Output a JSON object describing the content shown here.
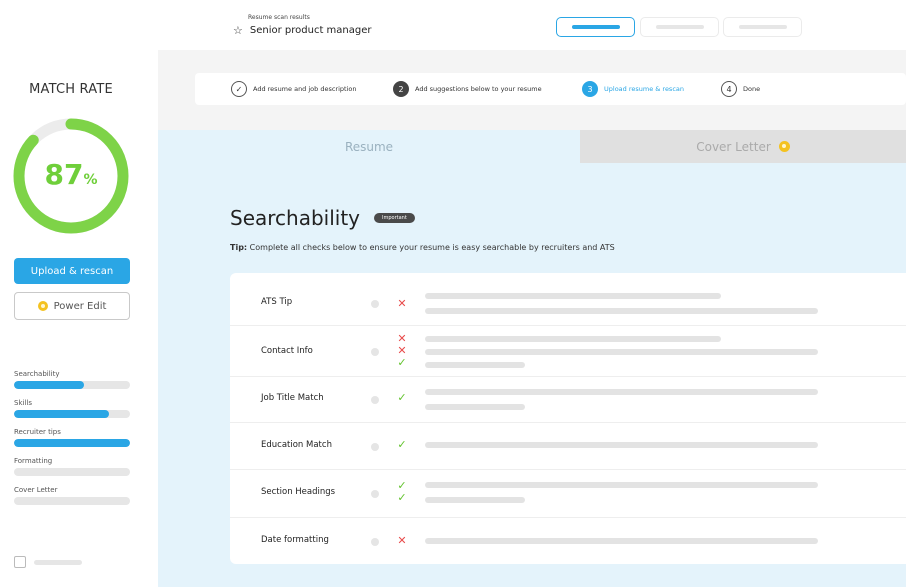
{
  "header": {
    "subtitle": "Resume scan results",
    "title": "Senior product manager",
    "tabs": [
      {
        "name": "tab-1",
        "active": true
      },
      {
        "name": "tab-2",
        "active": false
      },
      {
        "name": "tab-3",
        "active": false
      }
    ]
  },
  "sidebar": {
    "match_title": "MATCH RATE",
    "match_value": "87",
    "match_unit": "%",
    "match_fraction": 0.87,
    "rescan_label": "Upload & rescan",
    "power_edit_label": "Power Edit",
    "progress": [
      {
        "label": "Searchability",
        "value": 0.6
      },
      {
        "label": "Skills",
        "value": 0.82
      },
      {
        "label": "Recruiter tips",
        "value": 1.0
      },
      {
        "label": "Formatting",
        "value": 0
      },
      {
        "label": "Cover Letter",
        "value": 0
      }
    ]
  },
  "steps": [
    {
      "marker": "✓",
      "label": "Add resume and job description",
      "state": "done"
    },
    {
      "marker": "2",
      "label": "Add suggestions below to your resume",
      "state": "dark"
    },
    {
      "marker": "3",
      "label": "Upload resume & rescan",
      "state": "active"
    },
    {
      "marker": "4",
      "label": "Done",
      "state": "todo"
    }
  ],
  "tabs": {
    "resume": "Resume",
    "cover_letter": "Cover Letter"
  },
  "section": {
    "title": "Searchability",
    "badge": "Important",
    "tip_prefix": "Tip:",
    "tip_text": " Complete all checks below to ensure your resume is easy searchable by recruiters and ATS"
  },
  "checks": [
    {
      "label": "ATS Tip",
      "marks": [
        "fail"
      ]
    },
    {
      "label": "Contact Info",
      "marks": [
        "fail",
        "fail",
        "pass"
      ]
    },
    {
      "label": "Job Title Match",
      "marks": [
        "pass"
      ]
    },
    {
      "label": "Education Match",
      "marks": [
        "pass"
      ]
    },
    {
      "label": "Section Headings",
      "marks": [
        "pass",
        "pass"
      ]
    },
    {
      "label": "Date formatting",
      "marks": [
        "fail"
      ]
    }
  ],
  "colors": {
    "accent": "#2aa6e5",
    "gauge": "#7ed348",
    "pass": "#63c32e",
    "fail": "#e84b4b",
    "coin": "#f4c220"
  },
  "icons": {
    "star": "star-icon",
    "coin": "coin-icon",
    "check": "check-icon",
    "cross": "cross-icon"
  }
}
